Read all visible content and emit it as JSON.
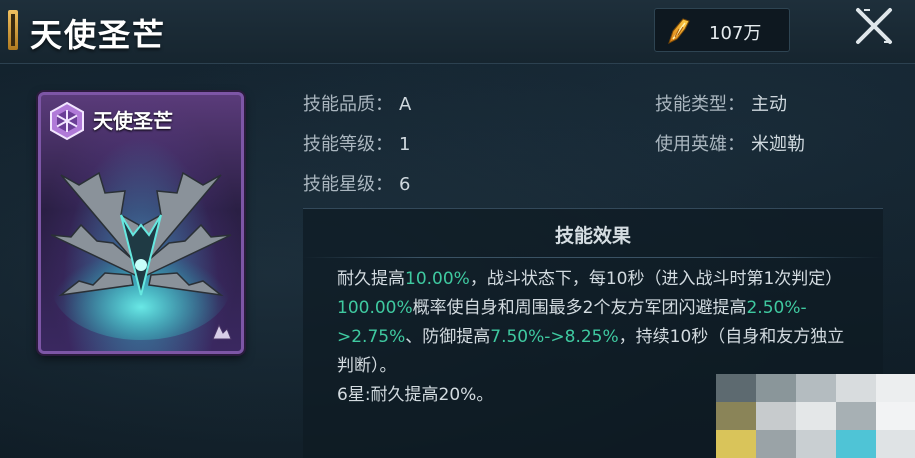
{
  "header": {
    "title": "天使圣芒",
    "currency_value": "107万",
    "currency_icon": "gold-feather-icon",
    "close_icon": "close-x-icon"
  },
  "card": {
    "name": "天使圣芒",
    "emblem_icon": "hexagon-emblem-icon",
    "art": "mechanical-wings-art",
    "border_color": "#7d56a6"
  },
  "info": {
    "quality_label": "技能品质：",
    "quality_value": "A",
    "level_label": "技能等级：",
    "level_value": "1",
    "star_label": "技能星级：",
    "star_value": "6",
    "type_label": "技能类型：",
    "type_value": "主动",
    "hero_label": "使用英雄：",
    "hero_value": "米迦勒"
  },
  "effect": {
    "title": "技能效果",
    "seg1": "耐久提高",
    "hl1": "10.00%",
    "seg2": "，战斗状态下，每10秒（进入战斗时第1次判定）",
    "hl2": "100.00%",
    "seg3": "概率使自身和周围最多2个友方军团闪避提高",
    "hl3": "2.50%->2.75%",
    "seg4": "、防御提高",
    "hl4": "7.50%->8.25%",
    "seg5": "，持续10秒（自身和友方独立判断）。",
    "star_line": "6星:耐久提高20%。",
    "highlight_color": "#3fc9a0"
  }
}
